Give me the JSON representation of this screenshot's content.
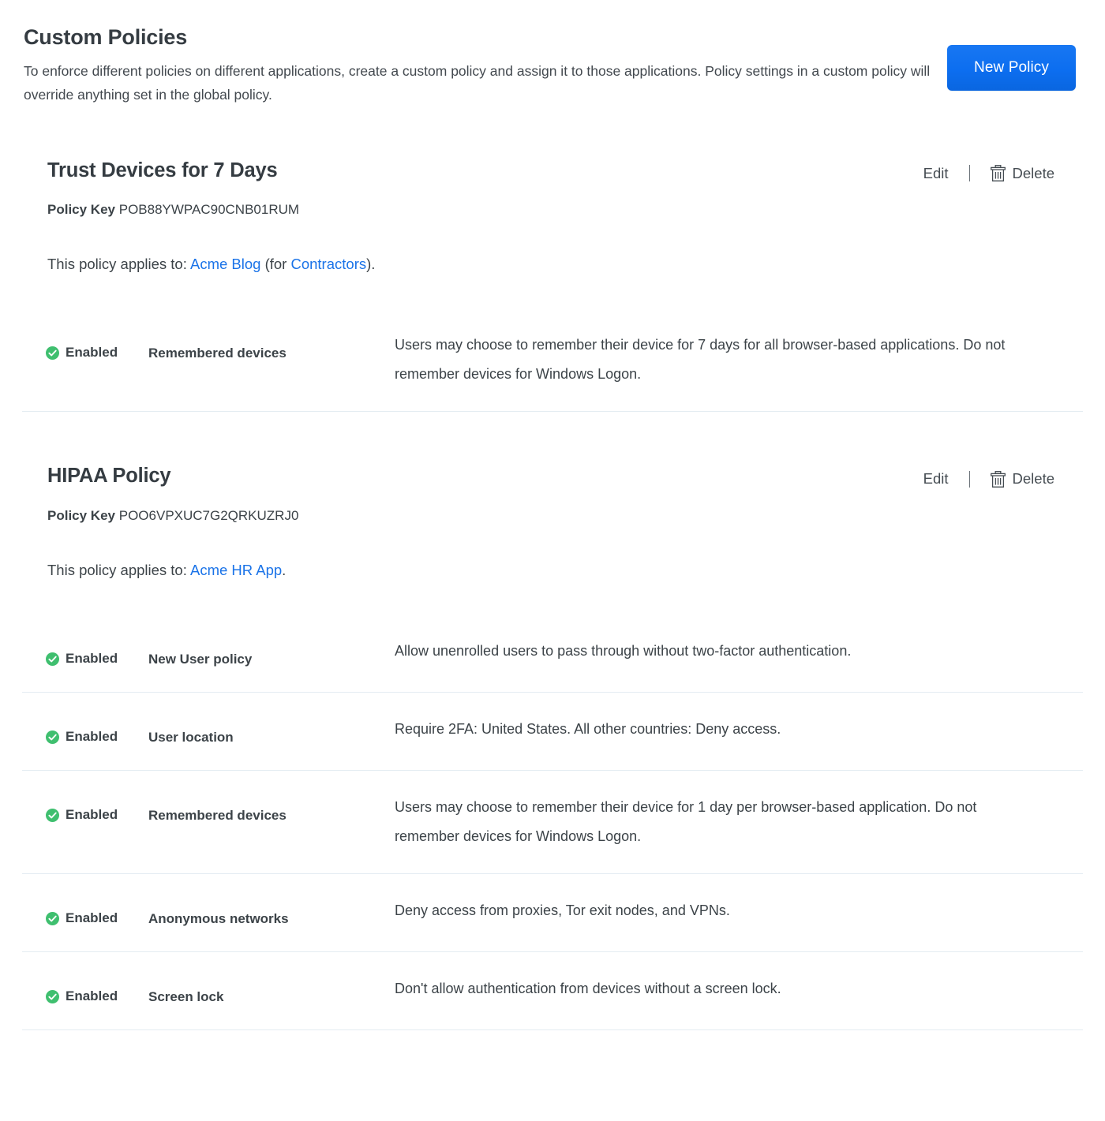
{
  "header": {
    "title": "Custom Policies",
    "description": "To enforce different policies on different applications, create a custom policy and assign it to those applications. Policy settings in a custom policy will override anything set in the global policy.",
    "new_policy_label": "New Policy"
  },
  "actions": {
    "edit_label": "Edit",
    "delete_label": "Delete",
    "delete_icon": "trash-icon"
  },
  "labels": {
    "policy_key_label": "Policy Key",
    "applies_prefix": "This policy applies to: ",
    "enabled_label": "Enabled",
    "enabled_icon": "check-circle-icon"
  },
  "colors": {
    "accent_blue": "#0c6ef0",
    "link_blue": "#1a73e8",
    "status_green": "#3fbf6f",
    "text_dark": "#3c4348",
    "divider": "#e4ecf2"
  },
  "policies": [
    {
      "title": "Trust Devices for 7 Days",
      "policy_key": "POB88YWPAC90CNB01RUM",
      "applies_to": {
        "app": "Acme Blog",
        "middle": " (for ",
        "group": "Contractors",
        "suffix": ")."
      },
      "settings": [
        {
          "status": "Enabled",
          "name": "Remembered devices",
          "description": "Users may choose to remember their device for 7 days for all browser-based applications. Do not remember devices for Windows Logon."
        }
      ]
    },
    {
      "title": "HIPAA Policy",
      "policy_key": "POO6VPXUC7G2QRKUZRJ0",
      "applies_to": {
        "app": "Acme HR App",
        "middle": "",
        "group": "",
        "suffix": "."
      },
      "settings": [
        {
          "status": "Enabled",
          "name": "New User policy",
          "description": "Allow unenrolled users to pass through without two-factor authentication."
        },
        {
          "status": "Enabled",
          "name": "User location",
          "description": "Require 2FA: United States. All other countries: Deny access."
        },
        {
          "status": "Enabled",
          "name": "Remembered devices",
          "description": "Users may choose to remember their device for 1 day per browser-based application. Do not remember devices for Windows Logon."
        },
        {
          "status": "Enabled",
          "name": "Anonymous networks",
          "description": "Deny access from proxies, Tor exit nodes, and VPNs."
        },
        {
          "status": "Enabled",
          "name": "Screen lock",
          "description": "Don't allow authentication from devices without a screen lock."
        }
      ]
    }
  ]
}
